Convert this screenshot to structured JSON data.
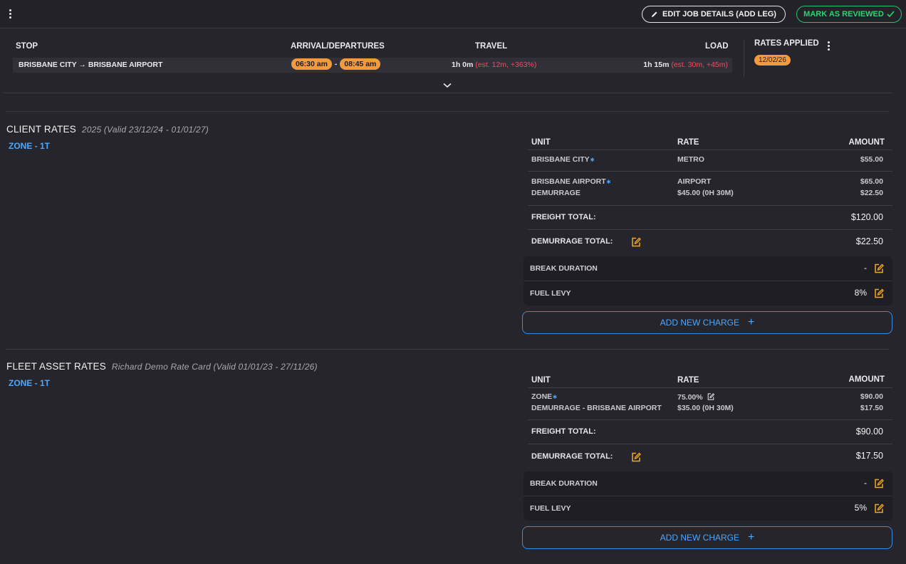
{
  "toolbar": {
    "edit_label": "EDIT JOB DETAILS (ADD LEG)",
    "review_label": "MARK AS REVIEWED"
  },
  "stops": {
    "headers": {
      "stop": "STOP",
      "arrival": "ARRIVAL/DEPARTURES",
      "travel": "TRAVEL",
      "load": "LOAD",
      "rates_applied": "RATES APPLIED"
    },
    "row": {
      "route": "BRISBANE CITY → BRISBANE AIRPORT",
      "arrival": "06:30 am",
      "separator": "-",
      "departure": "08:45 am",
      "travel": "1h 0m",
      "travel_est": "(est. 12m, +363%)",
      "load": "1h 15m",
      "load_est": "(est. 30m, +45m)"
    },
    "rates_date": "12/02/26"
  },
  "client": {
    "title": "CLIENT RATES",
    "subtitle": "2025  (Valid 23/12/24 - 01/01/27)",
    "zone": "ZONE - 1T",
    "headers": {
      "unit": "UNIT",
      "rate": "RATE",
      "amount": "AMOUNT"
    },
    "rows": [
      {
        "unit": "BRISBANE CITY",
        "rate": "METRO",
        "amount": "$55.00"
      },
      {
        "unit": "BRISBANE AIRPORT",
        "rate": "AIRPORT",
        "amount": "$65.00"
      },
      {
        "unit": "DEMURRAGE",
        "rate": "$45.00 (0H 30M)",
        "amount": "$22.50"
      }
    ],
    "freight_total_label": "FREIGHT TOTAL:",
    "freight_total": "$120.00",
    "demurrage_total_label": "DEMURRAGE TOTAL:",
    "demurrage_total": "$22.50",
    "break_label": "BREAK DURATION",
    "break_value": "-",
    "fuel_label": "FUEL LEVY",
    "fuel_value": "8%",
    "add_label": "ADD NEW CHARGE"
  },
  "fleet": {
    "title": "FLEET ASSET RATES",
    "subtitle": "Richard Demo Rate Card  (Valid 01/01/23 - 27/11/26)",
    "zone": "ZONE - 1T",
    "headers": {
      "unit": "UNIT",
      "rate": "RATE",
      "amount": "AMOUNT"
    },
    "rows": [
      {
        "unit": "ZONE",
        "rate": "75.00%",
        "amount": "$90.00"
      },
      {
        "unit": "DEMURRAGE - BRISBANE AIRPORT",
        "rate": "$35.00 (0H 30M)",
        "amount": "$17.50"
      }
    ],
    "freight_total_label": "FREIGHT TOTAL:",
    "freight_total": "$90.00",
    "demurrage_total_label": "DEMURRAGE TOTAL:",
    "demurrage_total": "$17.50",
    "break_label": "BREAK DURATION",
    "break_value": "-",
    "fuel_label": "FUEL LEVY",
    "fuel_value": "5%",
    "add_label": "ADD NEW CHARGE"
  },
  "colors": {
    "accent": "#4aa8ff",
    "pill": "#f39a3c",
    "success": "#22c36a",
    "warning_icon": "#f2a823",
    "delta_red": "#f04d5d"
  }
}
